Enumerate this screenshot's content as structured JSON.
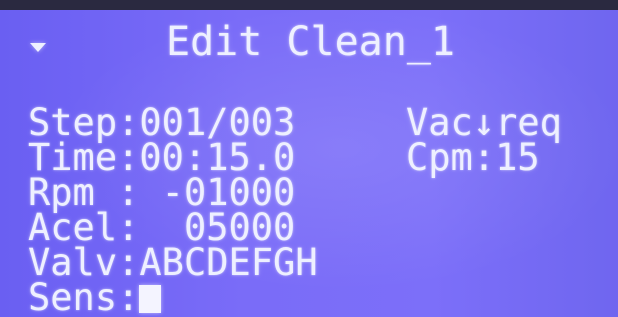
{
  "header": {
    "title": "Edit Clean_1",
    "menu_icon": "dropdown-arrow-icon"
  },
  "fields": {
    "step_label": "Step:",
    "step_value": "001/003",
    "time_label": "Time:",
    "time_value": "00:15.0",
    "rpm_label": "Rpm :",
    "rpm_value": " -01000",
    "acel_label": "Acel:",
    "acel_value": "  05000",
    "valv_label": "Valv:",
    "valv_value": "ABCDEFGH",
    "sens_label": "Sens:",
    "vac_label": "Vac↓req",
    "cpm_label": "Cpm:",
    "cpm_value": "15"
  },
  "colors": {
    "background": "#7a6cf8",
    "text": "#eef0ff"
  }
}
